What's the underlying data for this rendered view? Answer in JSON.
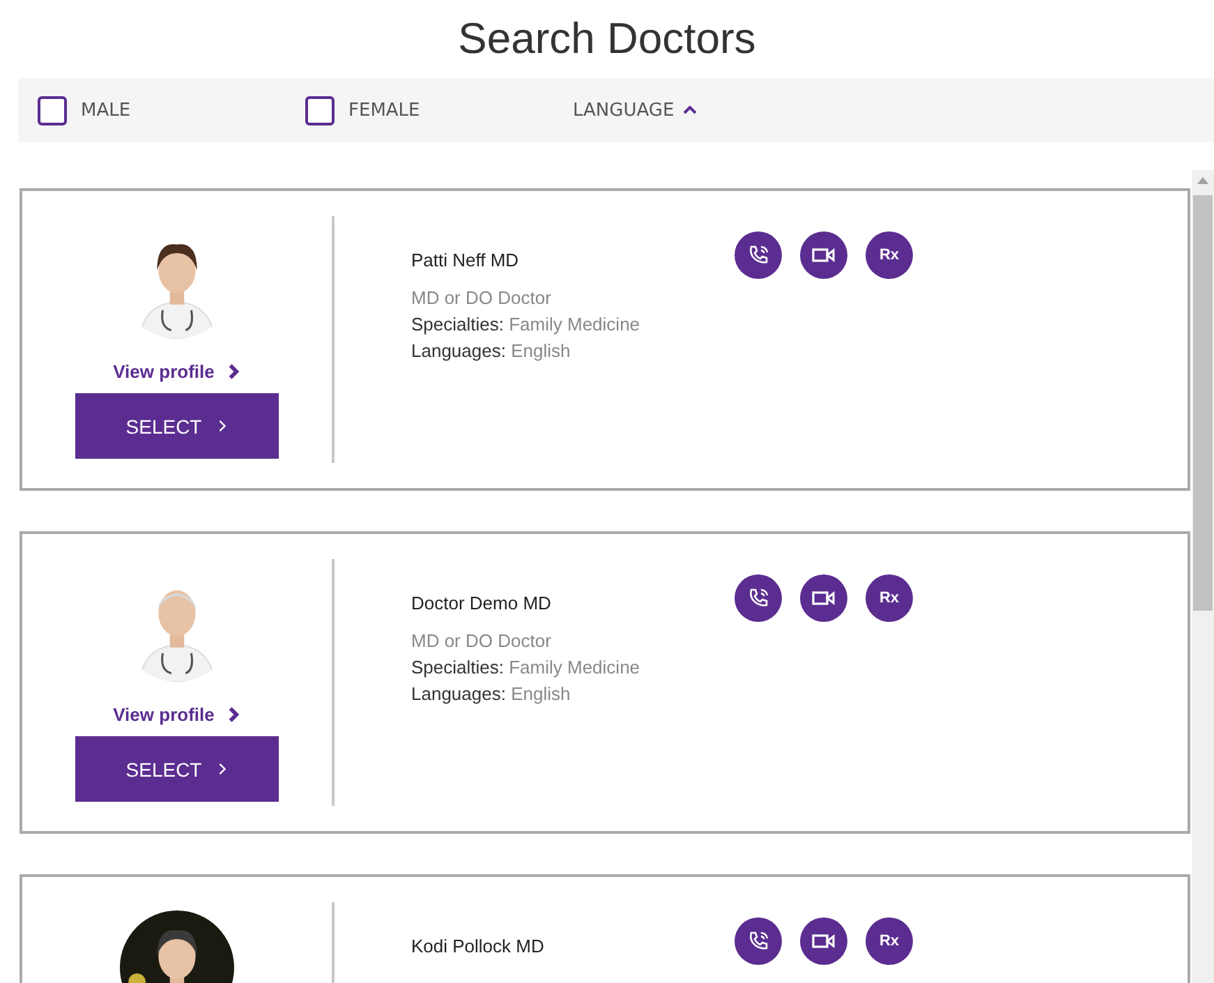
{
  "title": "Search Doctors",
  "filters": [
    {
      "kind": "checkbox",
      "label": "MALE",
      "checked": false
    },
    {
      "kind": "checkbox",
      "label": "FEMALE",
      "checked": false
    },
    {
      "kind": "dropdown",
      "label": "LANGUAGE",
      "expanded": true
    }
  ],
  "doctors": [
    {
      "view_profile": "View profile",
      "select": "SELECT",
      "name": "Patti Neff MD",
      "type": "MD or DO Doctor",
      "specialties_label": "Specialties:",
      "specialties": "Family Medicine",
      "languages_label": "Languages:",
      "languages": "English",
      "services": [
        {
          "kind": "phone"
        },
        {
          "kind": "video"
        },
        {
          "kind": "rx",
          "label": "Rx"
        }
      ]
    },
    {
      "view_profile": "View profile",
      "select": "SELECT",
      "name": "Doctor Demo MD",
      "type": "MD or DO Doctor",
      "specialties_label": "Specialties:",
      "specialties": "Family Medicine",
      "languages_label": "Languages:",
      "languages": "English",
      "services": [
        {
          "kind": "phone"
        },
        {
          "kind": "video"
        },
        {
          "kind": "rx",
          "label": "Rx"
        }
      ]
    },
    {
      "name": "Kodi Pollock MD",
      "services": [
        {
          "kind": "phone"
        },
        {
          "kind": "video"
        },
        {
          "kind": "rx",
          "label": "Rx"
        }
      ]
    }
  ]
}
